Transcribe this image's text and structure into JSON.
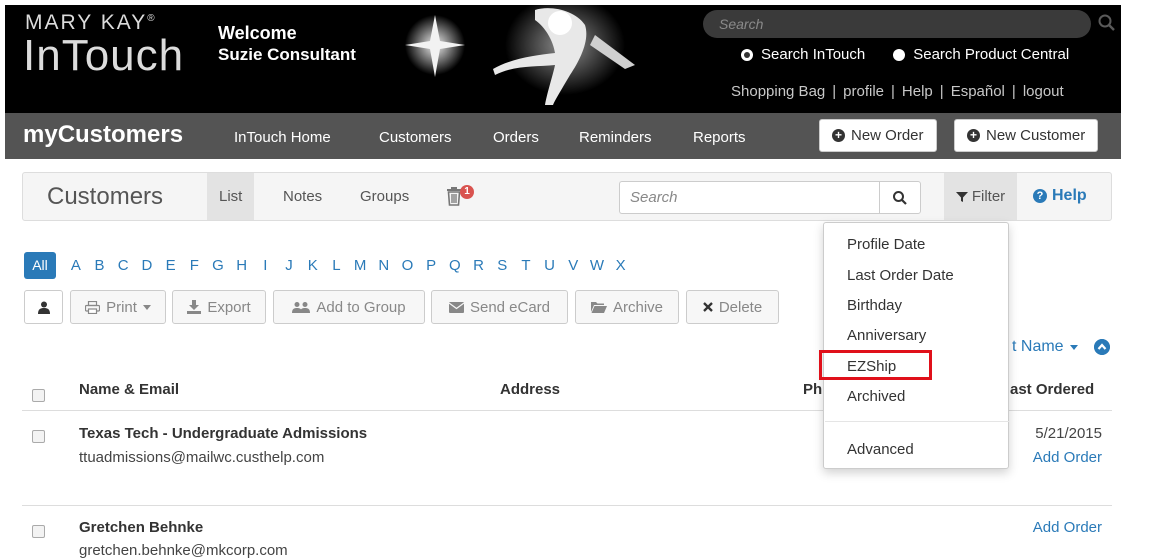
{
  "header": {
    "brand_top": "MARY KAY",
    "brand_mark": "®",
    "brand_main": "InTouch",
    "welcome": "Welcome",
    "user_name": "Suzie Consultant",
    "search_placeholder": "Search",
    "search_options": [
      {
        "label": "Search InTouch",
        "selected": true
      },
      {
        "label": "Search Product Central",
        "selected": false
      }
    ],
    "links": [
      "Shopping Bag",
      "profile",
      "Help",
      "Español",
      "logout"
    ]
  },
  "nav": {
    "app_title": "myCustomers",
    "items": [
      "InTouch Home",
      "Customers",
      "Orders",
      "Reminders",
      "Reports"
    ],
    "new_order": "New Order",
    "new_customer": "New Customer"
  },
  "toolbar": {
    "title": "Customers",
    "tabs": [
      "List",
      "Notes",
      "Groups"
    ],
    "active_tab": "List",
    "trash_badge": "1",
    "search_placeholder": "Search",
    "filter_label": "Filter",
    "help_label": "Help"
  },
  "alphabet": {
    "all": "All",
    "letters": [
      "A",
      "B",
      "C",
      "D",
      "E",
      "F",
      "G",
      "H",
      "I",
      "J",
      "K",
      "L",
      "M",
      "N",
      "O",
      "P",
      "Q",
      "R",
      "S",
      "T",
      "U",
      "V",
      "W",
      "X"
    ]
  },
  "actions": {
    "print": "Print",
    "export": "Export",
    "add_to_group": "Add to Group",
    "send_ecard": "Send eCard",
    "archive": "Archive",
    "delete": "Delete"
  },
  "sort": {
    "label_visible": "t Name"
  },
  "table": {
    "headers": {
      "name_email": "Name & Email",
      "address": "Address",
      "phone_partial": "Ph",
      "last_ordered_partial": "ast Ordered"
    },
    "rows": [
      {
        "name": "Texas Tech - Undergraduate Admissions",
        "email": "ttuadmissions@mailwc.custhelp.com",
        "last_ordered": "5/21/2015",
        "action": "Add Order"
      },
      {
        "name": "Gretchen Behnke",
        "email": "gretchen.behnke@mkcorp.com",
        "last_ordered": "",
        "action": "Add Order"
      }
    ]
  },
  "filter_menu": {
    "items": [
      "Profile Date",
      "Last Order Date",
      "Birthday",
      "Anniversary",
      "EZShip",
      "Archived"
    ],
    "advanced": "Advanced",
    "highlighted": "EZShip"
  },
  "colors": {
    "link_blue": "#2a7ab8",
    "nav_gray": "#545454",
    "highlight_red": "#e0101a",
    "badge_red": "#d9534f"
  }
}
